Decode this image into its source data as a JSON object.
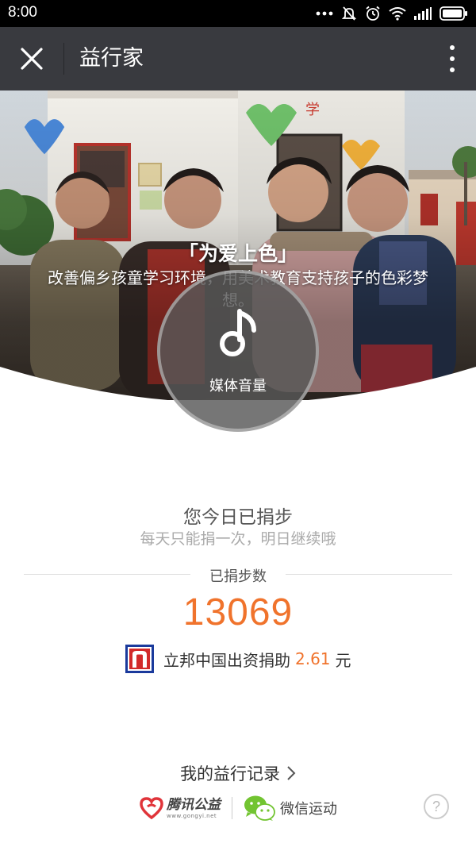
{
  "status_bar": {
    "time": "8:00",
    "icons": [
      "more-dots-icon",
      "mute-icon",
      "alarm-icon",
      "wifi-icon",
      "signal-icon",
      "battery-icon"
    ]
  },
  "nav": {
    "title": "益行家",
    "close_icon": "close-icon",
    "more_icon": "more-vertical-icon"
  },
  "hero": {
    "title": "「为爱上色」",
    "description": "改善偏乡孩童学习环境，用美术教育支持孩子的色彩梦想。"
  },
  "volume_toast": {
    "label": "媒体音量",
    "icon": "music-note-icon"
  },
  "donation": {
    "title": "您今日已捐步",
    "subtitle": "每天只能捐一次，明日继续哦",
    "steps_label": "已捐步数",
    "steps": "13069",
    "sponsor_prefix": "立邦中国出资捐助",
    "sponsor_amount": "2.61",
    "sponsor_unit": "元"
  },
  "footer": {
    "record_label": "我的益行记录",
    "tencent_logo_name": "腾讯公益",
    "tencent_logo_url": "www.gongyi.net",
    "wechat_label": "微信运动",
    "help_label": "?"
  },
  "colors": {
    "accent_orange": "#f0732c",
    "nav_background": "#393a3f",
    "status_background": "#000000"
  }
}
